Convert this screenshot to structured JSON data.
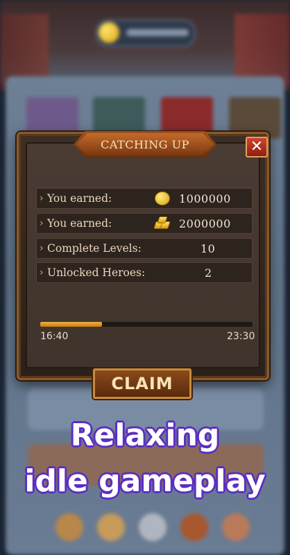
{
  "dialog": {
    "title": "CATCHING UP",
    "close_label": "✕",
    "rows": [
      {
        "label": "You earned:",
        "icon": "gold-coin-icon",
        "value": "1000000"
      },
      {
        "label": "You earned:",
        "icon": "gold-bars-icon",
        "value": "2000000"
      },
      {
        "label": "Complete Levels:",
        "value": "10"
      },
      {
        "label": "Unlocked Heroes:",
        "value": "2"
      }
    ],
    "progress": {
      "fraction": 0.29,
      "start_time": "16:40",
      "end_time": "23:30"
    },
    "claim_label": "CLAIM"
  },
  "promo": {
    "line1": "Relaxing",
    "line2": "idle gameplay"
  },
  "colors": {
    "accent": "#f3b043",
    "promo_outline": "#5a2fc2",
    "close": "#c4392a"
  }
}
